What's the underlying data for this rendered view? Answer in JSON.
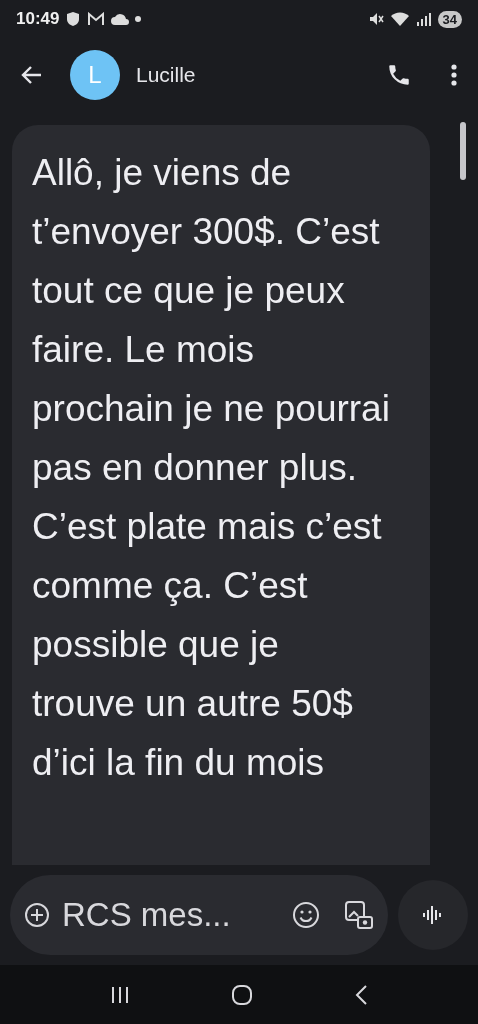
{
  "status_bar": {
    "time": "10:49",
    "battery": "34"
  },
  "header": {
    "avatar_letter": "L",
    "contact_name": "Lucille"
  },
  "messages": [
    {
      "text": "Allô, je viens de t’envoyer 300$. C’est tout ce que je peux faire. Le mois prochain je ne pourrai pas en donner plus. C’est plate mais c’est comme ça. C’est possible que je trouve un autre 50$ d’ici la fin du mois"
    }
  ],
  "composer": {
    "placeholder": "RCS mes..."
  }
}
